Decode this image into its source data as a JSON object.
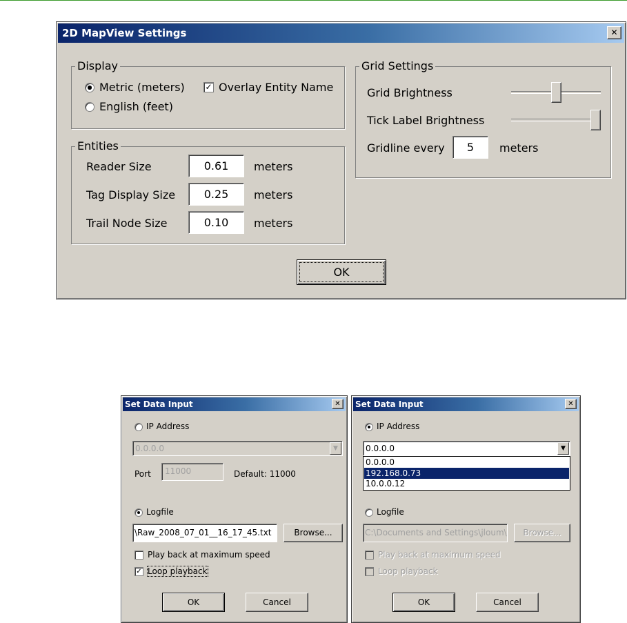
{
  "mapview": {
    "title": "2D MapView Settings",
    "close_glyph": "✕",
    "display": {
      "group_label": "Display",
      "metric_label": "Metric (meters)",
      "metric_selected": true,
      "english_label": "English (feet)",
      "english_selected": false,
      "overlay_label": "Overlay Entity Name",
      "overlay_checked": true
    },
    "entities": {
      "group_label": "Entities",
      "rows": [
        {
          "label": "Reader Size",
          "value": "0.61",
          "unit": "meters"
        },
        {
          "label": "Tag Display Size",
          "value": "0.25",
          "unit": "meters"
        },
        {
          "label": "Trail Node Size",
          "value": "0.10",
          "unit": "meters"
        }
      ]
    },
    "grid": {
      "group_label": "Grid Settings",
      "brightness_label": "Grid Brightness",
      "brightness_level": 0.5,
      "tick_label": "Tick Label Brightness",
      "tick_level": 1.0,
      "gridline_label": "Gridline every",
      "gridline_value": "5",
      "gridline_unit": "meters"
    },
    "ok_label": "OK"
  },
  "dialog_left": {
    "title": "Set Data Input",
    "close_glyph": "✕",
    "ip_label": "IP Address",
    "ip_selected": false,
    "ip_value": "0.0.0.0",
    "port_label": "Port",
    "port_value": "11000",
    "default_label": "Default: 11000",
    "logfile_label": "Logfile",
    "logfile_selected": true,
    "logfile_value": "\\Raw_2008_07_01__16_17_45.txt",
    "browse_label": "Browse...",
    "playback_label": "Play back at maximum speed",
    "playback_checked": false,
    "loop_label": "Loop playback",
    "loop_checked": true,
    "ok_label": "OK",
    "cancel_label": "Cancel"
  },
  "dialog_right": {
    "title": "Set Data Input",
    "close_glyph": "✕",
    "ip_label": "IP Address",
    "ip_selected": true,
    "ip_value": "0.0.0.0",
    "ip_options": [
      "0.0.0.0",
      "192.168.0.73",
      "10.0.0.12"
    ],
    "ip_highlighted": "192.168.0.73",
    "logfile_label": "Logfile",
    "logfile_selected": false,
    "logfile_value": "C:\\Documents and Settings\\jloum\\",
    "browse_label": "Browse...",
    "playback_label": "Play back at maximum speed",
    "playback_checked": false,
    "loop_label": "Loop playback",
    "loop_checked": false,
    "ok_label": "OK",
    "cancel_label": "Cancel"
  },
  "colors": {
    "dialog_face": "#d4d0c8",
    "titlebar_start": "#0a246a",
    "titlebar_end": "#a6caf0",
    "selection": "#0a246a",
    "accent_line": "#3a9a2a"
  },
  "icons": {
    "close": "close-icon",
    "dropdown": "chevron-down-icon"
  }
}
